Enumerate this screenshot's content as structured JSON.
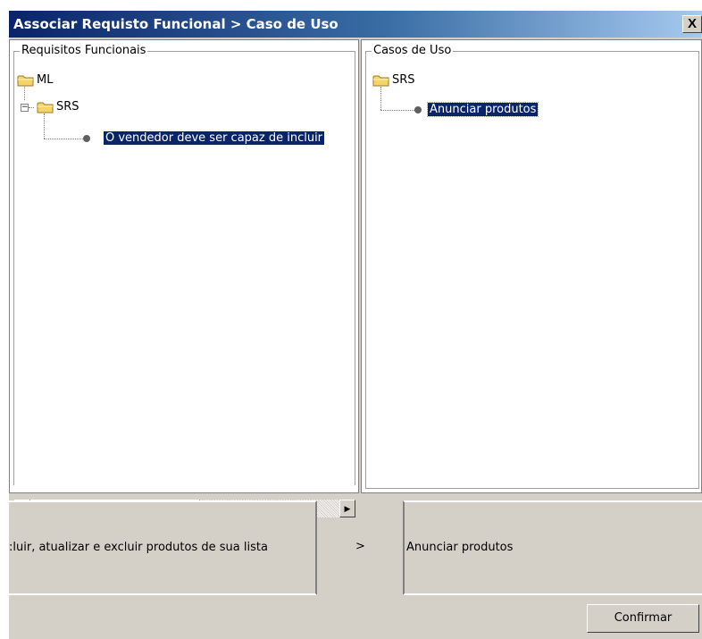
{
  "window": {
    "title": "Associar Requisto Funcional > Caso de Uso",
    "close_label": "X"
  },
  "left_panel": {
    "legend": "Requisitos Funcionais",
    "tree": {
      "root": "ML",
      "child": "SRS",
      "leaf": "O vendedor deve ser capaz de incluir"
    }
  },
  "right_panel": {
    "legend": "Casos de Uso",
    "tree": {
      "root": "SRS",
      "leaf": "Anunciar produtos"
    }
  },
  "scrollbar": {
    "left_arrow": "◀",
    "right_arrow": "▶"
  },
  "association": {
    "requirement_text": ":luir, atualizar e excluir produtos de sua lista",
    "arrow": ">",
    "use_case_text": "Anunciar produtos"
  },
  "actions": {
    "confirm_label": "Confirmar"
  },
  "colors": {
    "title_bar": "#0a246a",
    "selection": "#0a246a",
    "window_bg": "#d4d0c8",
    "folder": "#f3d36b"
  }
}
